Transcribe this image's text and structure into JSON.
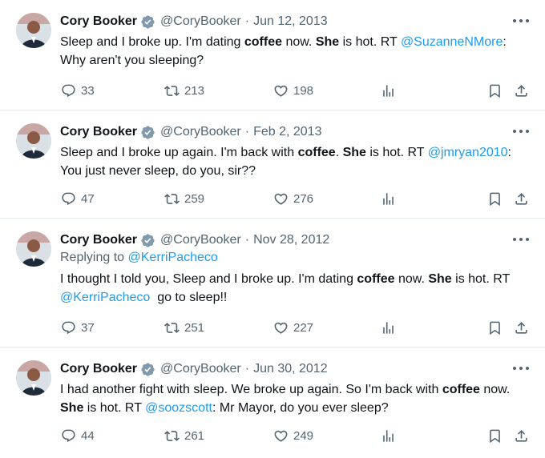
{
  "tweets": [
    {
      "author": "Cory Booker",
      "handle": "@CoryBooker",
      "sep": "·",
      "date": "Jun 12, 2013",
      "reply_prefix": "",
      "reply_to": "",
      "text": {
        "p1": "Sleep and I broke up. I'm dating ",
        "b1": "coffee",
        "p2": " now. ",
        "b2": "She",
        "p3": " is hot. RT ",
        "mention": "@SuzanneNMore",
        "p4": ": Why aren't you sleeping?",
        "p5": ""
      },
      "replies": "33",
      "retweets": "213",
      "likes": "198"
    },
    {
      "author": "Cory Booker",
      "handle": "@CoryBooker",
      "sep": "·",
      "date": "Feb 2, 2013",
      "reply_prefix": "",
      "reply_to": "",
      "text": {
        "p1": "Sleep and I broke up again. I'm back with ",
        "b1": "coffee",
        "p2": ". ",
        "b2": "She",
        "p3": " is hot. RT ",
        "mention": "@jmryan2010",
        "p4": ": You just never sleep, do you, sir??",
        "p5": ""
      },
      "replies": "47",
      "retweets": "259",
      "likes": "276"
    },
    {
      "author": "Cory Booker",
      "handle": "@CoryBooker",
      "sep": "·",
      "date": "Nov 28, 2012",
      "reply_prefix": "Replying to ",
      "reply_to": "@KerriPacheco",
      "text": {
        "p1": "I thought I told you, Sleep and I broke up. I'm dating ",
        "b1": "coffee",
        "p2": " now. ",
        "b2": "She",
        "p3": " is hot. RT ",
        "mention": "@KerriPacheco",
        "p4": "  go to sleep!!",
        "p5": ""
      },
      "replies": "37",
      "retweets": "251",
      "likes": "227"
    },
    {
      "author": "Cory Booker",
      "handle": "@CoryBooker",
      "sep": "·",
      "date": "Jun 30, 2012",
      "reply_prefix": "",
      "reply_to": "",
      "text": {
        "p1": "I had another fight with sleep. We broke up again. So I'm back with ",
        "b1": "coffee",
        "p2": " now. ",
        "b2": "She",
        "p3": " is hot. RT ",
        "mention": "@soozscott",
        "p4": ": Mr Mayor, do you ever sleep?",
        "p5": ""
      },
      "replies": "44",
      "retweets": "261",
      "likes": "249"
    }
  ],
  "icons": {
    "verified": "verified-badge-icon",
    "more": "more-dots-icon",
    "reply": "reply-bubble-icon",
    "retweet": "retweet-icon",
    "like": "heart-icon",
    "views": "views-bar-chart-icon",
    "bookmark": "bookmark-icon",
    "share": "share-upload-icon"
  },
  "colors": {
    "text": "#0f1419",
    "muted": "#536471",
    "link": "#1d9bf0",
    "verified": "#829aab",
    "divider": "#e6ecf0"
  }
}
